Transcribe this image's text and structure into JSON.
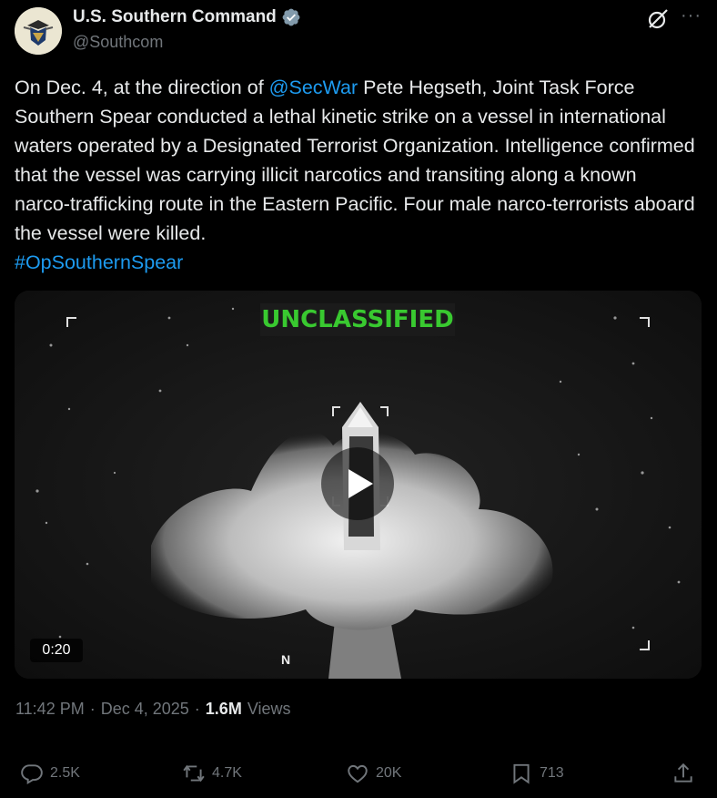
{
  "author": {
    "name": "U.S. Southern Command",
    "handle": "@Southcom",
    "verified": true
  },
  "tweet": {
    "text_part1": "On Dec. 4, at the direction of ",
    "mention": "@SecWar",
    "text_part2": " Pete Hegseth, Joint Task Force Southern Spear conducted a lethal kinetic strike on a vessel in international waters operated by a Designated Terrorist Organization. Intelligence confirmed that the vessel was carrying illicit narcotics and transiting along a known narco-trafficking route in the Eastern Pacific. Four male narco-terrorists aboard the vessel were killed.",
    "hashtag": "#OpSouthernSpear"
  },
  "media": {
    "overlay_label": "UNCLASSIFIED",
    "compass_label": "N",
    "duration": "0:20"
  },
  "meta": {
    "time": "11:42 PM",
    "separator": "·",
    "date": "Dec 4, 2025",
    "views_count": "1.6M",
    "views_label": "Views"
  },
  "actions": {
    "replies": "2.5K",
    "reposts": "4.7K",
    "likes": "20K",
    "bookmarks": "713"
  },
  "colors": {
    "link": "#1d9bf0",
    "muted": "#71767b",
    "text": "#e7e9ea",
    "overlay_green": "#39c930"
  },
  "icons": [
    "verified-badge-icon",
    "grok-icon",
    "more-icon",
    "play-icon",
    "reply-icon",
    "repost-icon",
    "like-icon",
    "bookmark-icon",
    "share-icon"
  ]
}
